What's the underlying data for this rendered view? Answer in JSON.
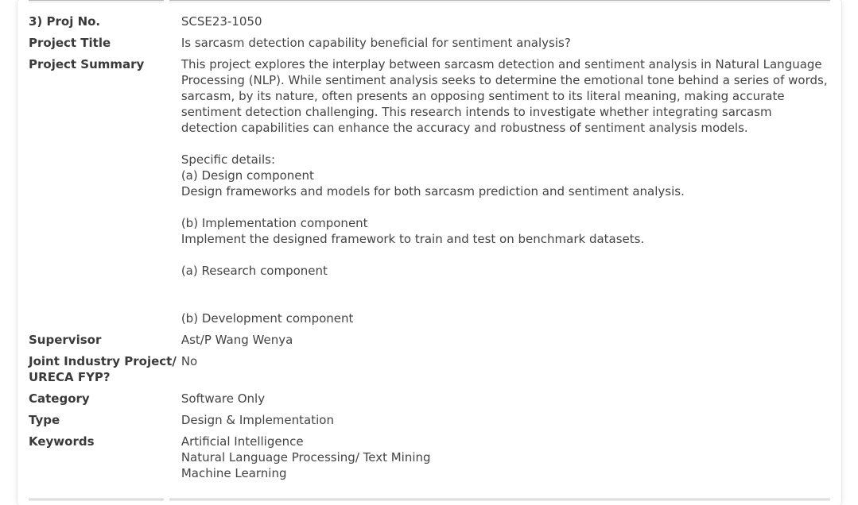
{
  "project": {
    "proj_no": {
      "label": "3) Proj No.",
      "value": "SCSE23-1050"
    },
    "title": {
      "label": "Project Title",
      "value": "Is sarcasm detection capability beneficial for sentiment analysis?"
    },
    "summary": {
      "label": "Project Summary",
      "intro": "This project explores the interplay between sarcasm detection and sentiment analysis in Natural Language Processing (NLP). While sentiment analysis seeks to determine the emotional tone behind a series of words, sarcasm, by its nature, often presents an opposing sentiment to its literal meaning, making accurate sentiment detection challenging. This research intends to investigate whether integrating sarcasm detection capabilities can enhance the accuracy and robustness of sentiment analysis models.",
      "specific_heading": "Specific details:",
      "design_heading": "(a) Design component",
      "design_text": "Design frameworks and models for both sarcasm prediction and sentiment analysis.",
      "impl_heading": "(b) Implementation component",
      "impl_text": "Implement the designed framework to train and test on benchmark datasets.",
      "research_heading": "(a) Research component",
      "dev_heading": "(b) Development component"
    },
    "supervisor": {
      "label": "Supervisor",
      "value": "Ast/P Wang Wenya"
    },
    "joint": {
      "label_line1": "Joint Industry Project/",
      "label_line2": "URECA FYP?",
      "value": "No"
    },
    "category": {
      "label": "Category",
      "value": "Software Only"
    },
    "type": {
      "label": "Type",
      "value": "Design & Implementation"
    },
    "keywords": {
      "label": "Keywords",
      "items": [
        "Artificial Intelligence",
        "Natural Language Processing/ Text Mining",
        "Machine Learning"
      ]
    }
  }
}
